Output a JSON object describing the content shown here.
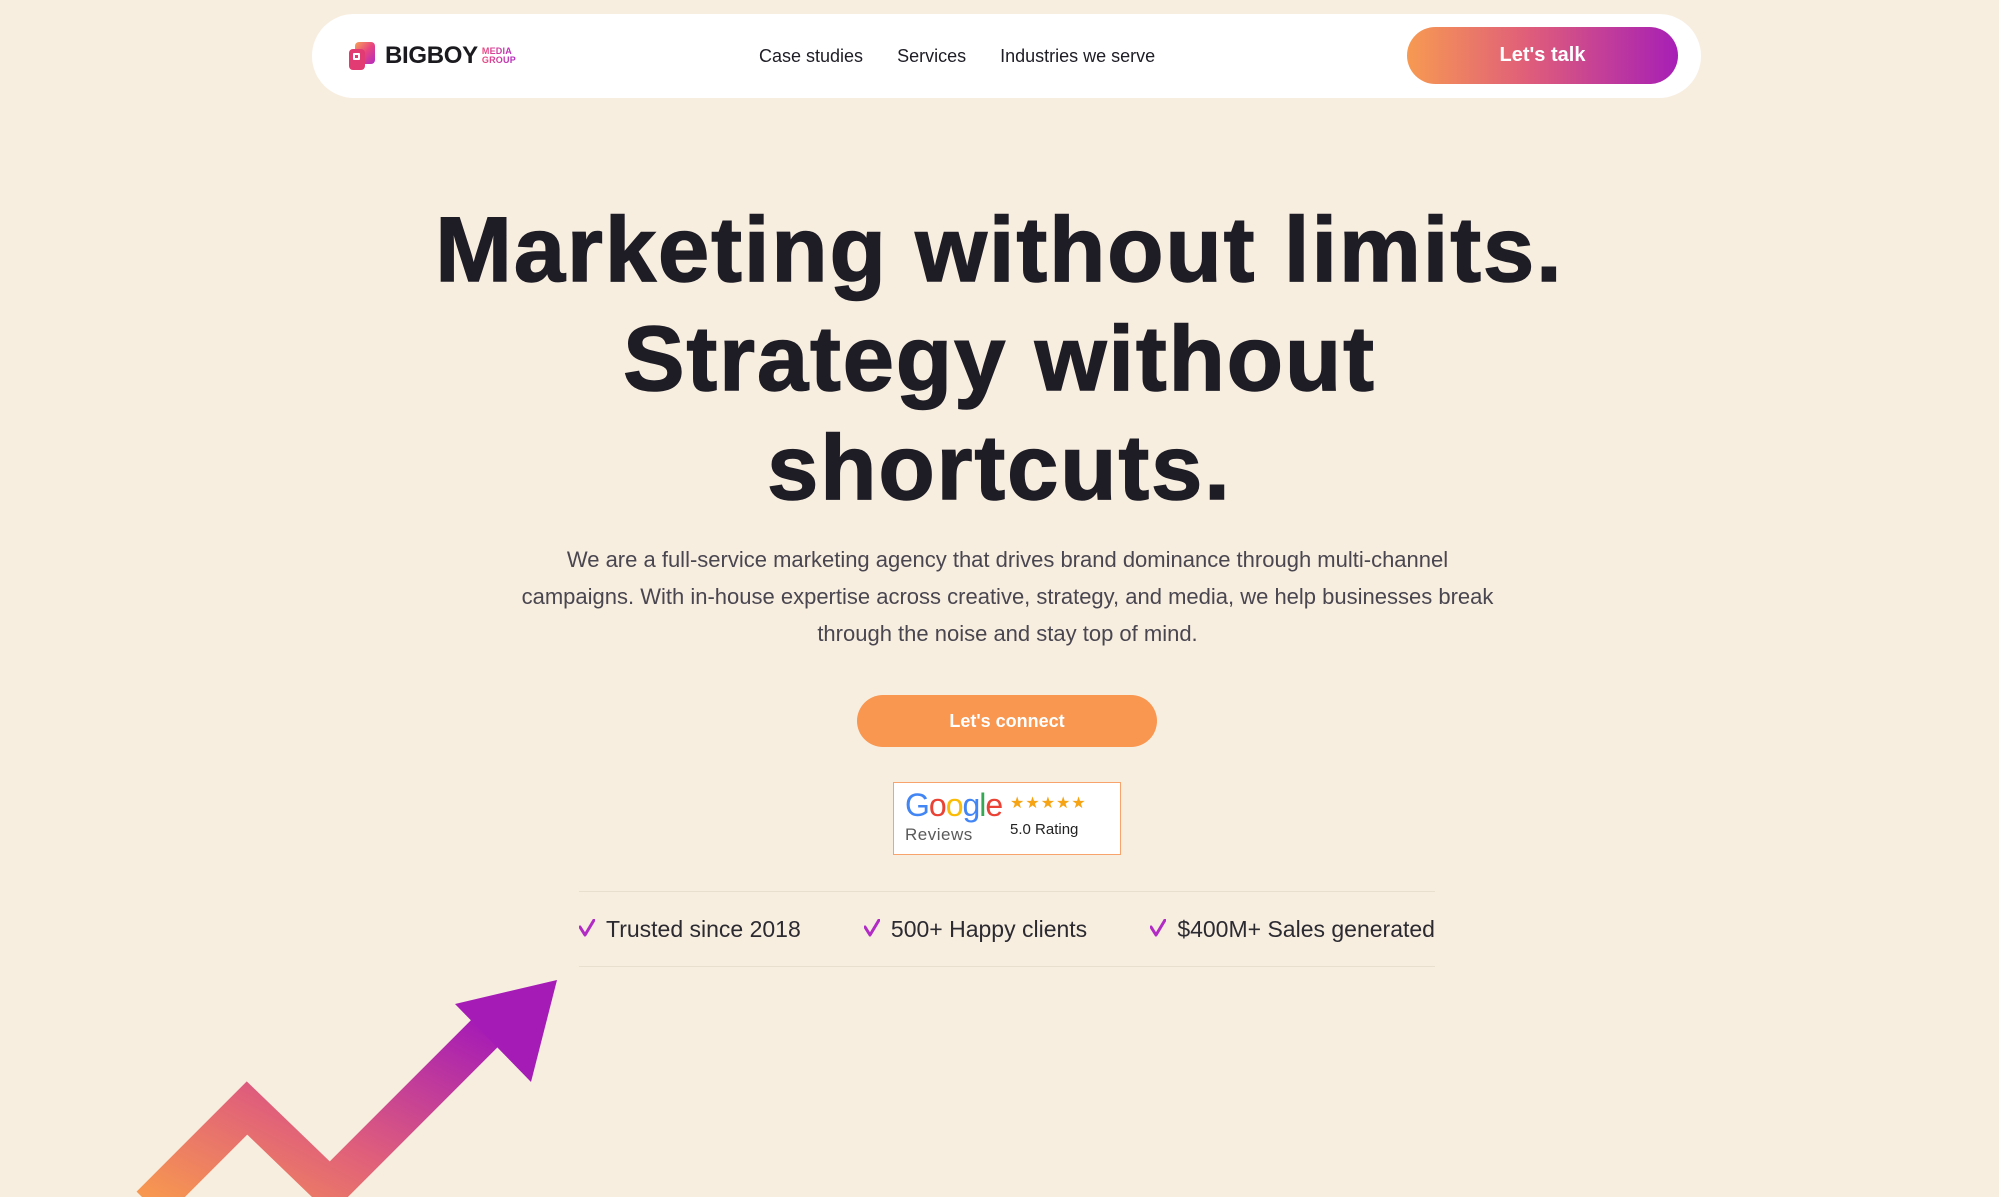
{
  "nav": {
    "logo": {
      "name": "BIGBOY",
      "sub_line1": "MEDIA",
      "sub_line2": "GROUP"
    },
    "links": [
      "Case studies",
      "Services",
      "Industries we serve"
    ],
    "cta_label": "Let's talk"
  },
  "hero": {
    "title_lines": [
      "Marketing without limits.",
      "Strategy without",
      "shortcuts."
    ],
    "subtitle": "We are a full-service marketing agency that drives brand dominance through multi-channel campaigns. With in-house expertise across creative, strategy, and media, we help businesses break through the noise and stay top of mind.",
    "cta_label": "Let's connect"
  },
  "google_badge": {
    "brand": "Google",
    "reviews_label": "Reviews",
    "stars": 5,
    "rating_label": "5.0 Rating"
  },
  "trust": {
    "items": [
      "Trusted since 2018",
      "500+ Happy clients",
      "$400M+ Sales generated"
    ]
  },
  "colors": {
    "background": "#f7eee0",
    "text_dark": "#1e1c25",
    "orange": "#f99650",
    "magenta": "#a61fb6",
    "check": "#b12bc4"
  },
  "icons": {
    "logo": "bigboy-logo-icon",
    "check": "check-icon",
    "star": "star-icon",
    "arrow": "growth-arrow-icon"
  }
}
